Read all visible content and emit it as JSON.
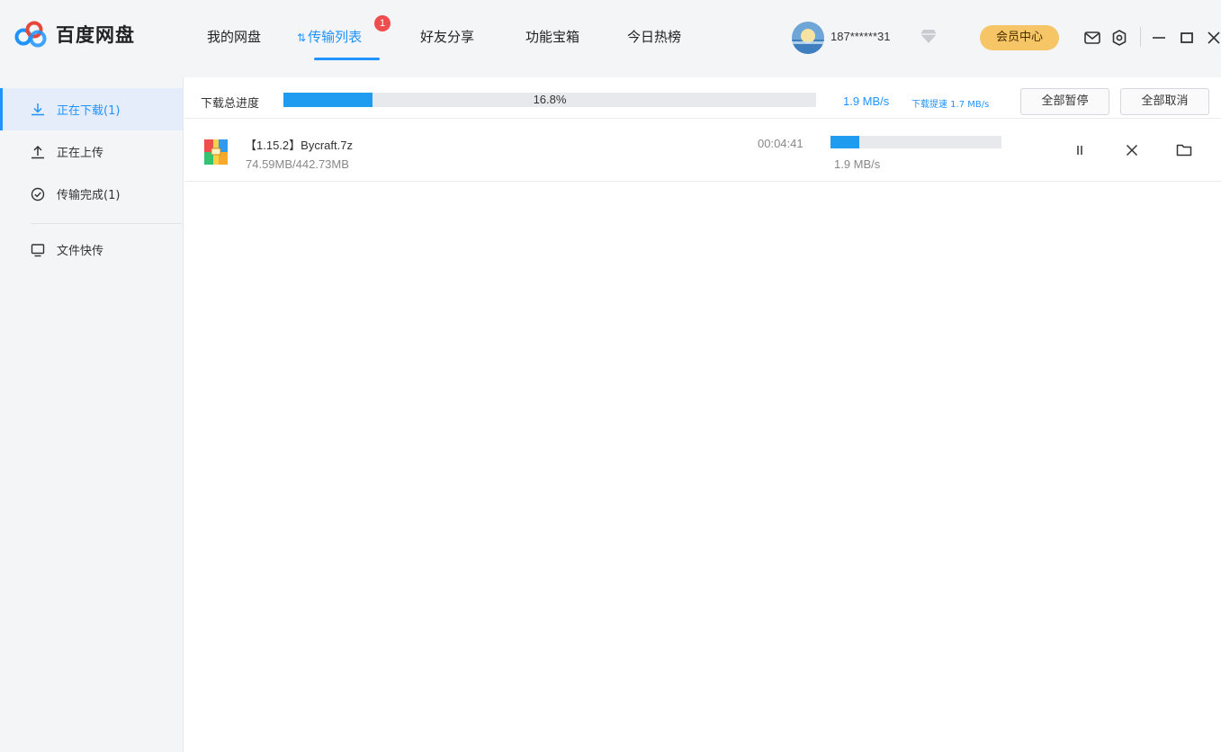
{
  "app": {
    "name": "百度网盘",
    "brand_colors": [
      "#1f93ff",
      "#e5483b",
      "#f6a92a",
      "#34c471"
    ]
  },
  "nav": {
    "tabs": [
      {
        "label": "我的网盘"
      },
      {
        "label": "传输列表",
        "active": true,
        "badge": "1"
      },
      {
        "label": "好友分享"
      },
      {
        "label": "功能宝箱"
      },
      {
        "label": "今日热榜"
      }
    ]
  },
  "user": {
    "name": "187******31",
    "vip_button": "会员中心"
  },
  "header_icons": [
    "mail-icon",
    "settings-icon",
    "minimize-icon",
    "maximize-icon",
    "close-icon"
  ],
  "sidebar": {
    "items": [
      {
        "label": "正在下载(1)",
        "icon": "download-icon",
        "active": true
      },
      {
        "label": "正在上传",
        "icon": "upload-icon"
      },
      {
        "label": "传输完成(1)",
        "icon": "check-circle-icon"
      },
      {
        "label": "文件快传",
        "icon": "monitor-icon"
      }
    ]
  },
  "total": {
    "label": "下载总进度",
    "progress_pct": 16.8,
    "progress_text": "16.8%",
    "speed": "1.9 MB/s",
    "speedup": "下载提速 1.7 MB/s",
    "pause_all": "全部暂停",
    "cancel_all": "全部取消"
  },
  "downloads": [
    {
      "name": "【1.15.2】Bycraft.7z",
      "size": "74.59MB/442.73MB",
      "time_left": "00:04:41",
      "progress_pct": 16.8,
      "speed": "1.9 MB/s",
      "icon": "archive-file-icon"
    }
  ]
}
